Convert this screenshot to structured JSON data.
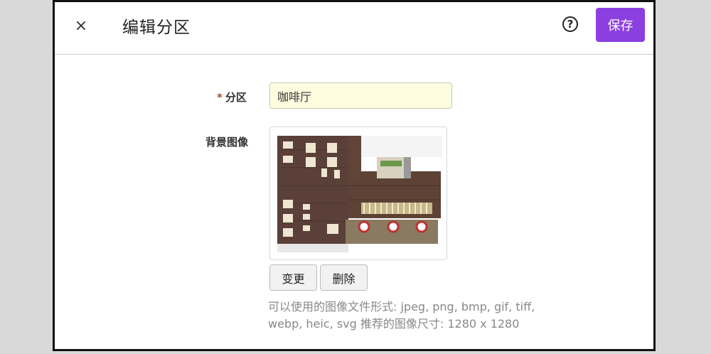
{
  "dialog": {
    "title": "编辑分区",
    "close_icon": "×",
    "help_icon": "?",
    "save_label": "保存"
  },
  "form": {
    "zone_label": "分区",
    "required_mark": "*",
    "zone_value": "咖啡厅",
    "bg_label": "背景图像",
    "change_label": "变更",
    "delete_label": "删除",
    "hint_line1": "可以使用的图像文件形式: jpeg, png, bmp, gif, tiff,",
    "hint_line2": "webp, heic, svg 推荐的图像尺寸: 1280 x 1280"
  },
  "colors": {
    "accent": "#8b3fe0",
    "input_bg": "#fffde0"
  }
}
